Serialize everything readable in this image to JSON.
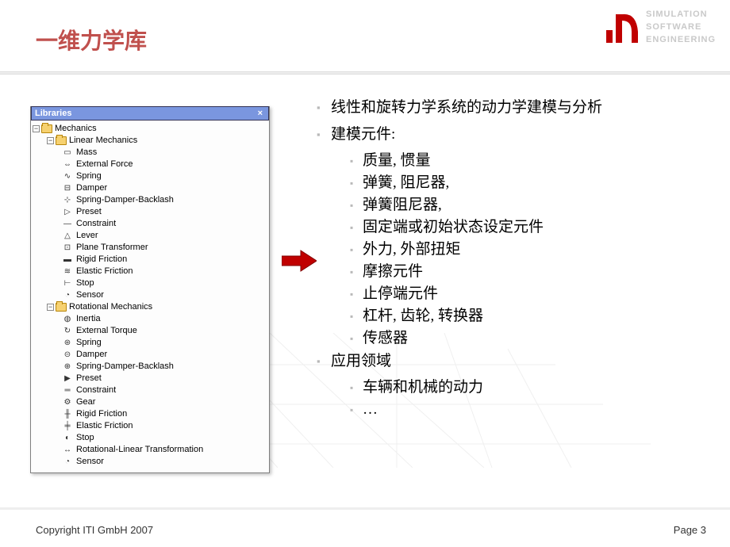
{
  "header": {
    "title": "一维力学库",
    "brand_lines": [
      "SIMULATION",
      "SOFTWARE",
      "ENGINEERING"
    ]
  },
  "lib": {
    "title": "Libraries",
    "close": "×",
    "root": "Mechanics",
    "linear": {
      "label": "Linear Mechanics",
      "items": [
        "Mass",
        "External Force",
        "Spring",
        "Damper",
        "Spring-Damper-Backlash",
        "Preset",
        "Constraint",
        "Lever",
        "Plane Transformer",
        "Rigid Friction",
        "Elastic Friction",
        "Stop",
        "Sensor"
      ]
    },
    "rotational": {
      "label": "Rotational Mechanics",
      "items": [
        "Inertia",
        "External Torque",
        "Spring",
        "Damper",
        "Spring-Damper-Backlash",
        "Preset",
        "Constraint",
        "Gear",
        "Rigid Friction",
        "Elastic Friction",
        "Stop",
        "Rotational-Linear Transformation",
        "Sensor"
      ]
    }
  },
  "content": {
    "l1": "线性和旋转力学系统的动力学建模与分析",
    "l2": "建模元件:",
    "s1": "质量, 惯量",
    "s2": "弹簧, 阻尼器,",
    "s3": "弹簧阻尼器,",
    "s4": "固定端或初始状态设定元件",
    "s5": "外力, 外部扭矩",
    "s6": "摩擦元件",
    "s7": "止停端元件",
    "s8": "杠杆, 齿轮, 转换器",
    "s9": "传感器",
    "l3": "应用领域",
    "s10": "车辆和机械的动力",
    "s11": "…"
  },
  "footer": {
    "copyright": "Copyright ITI GmbH 2007",
    "page": "Page 3"
  }
}
